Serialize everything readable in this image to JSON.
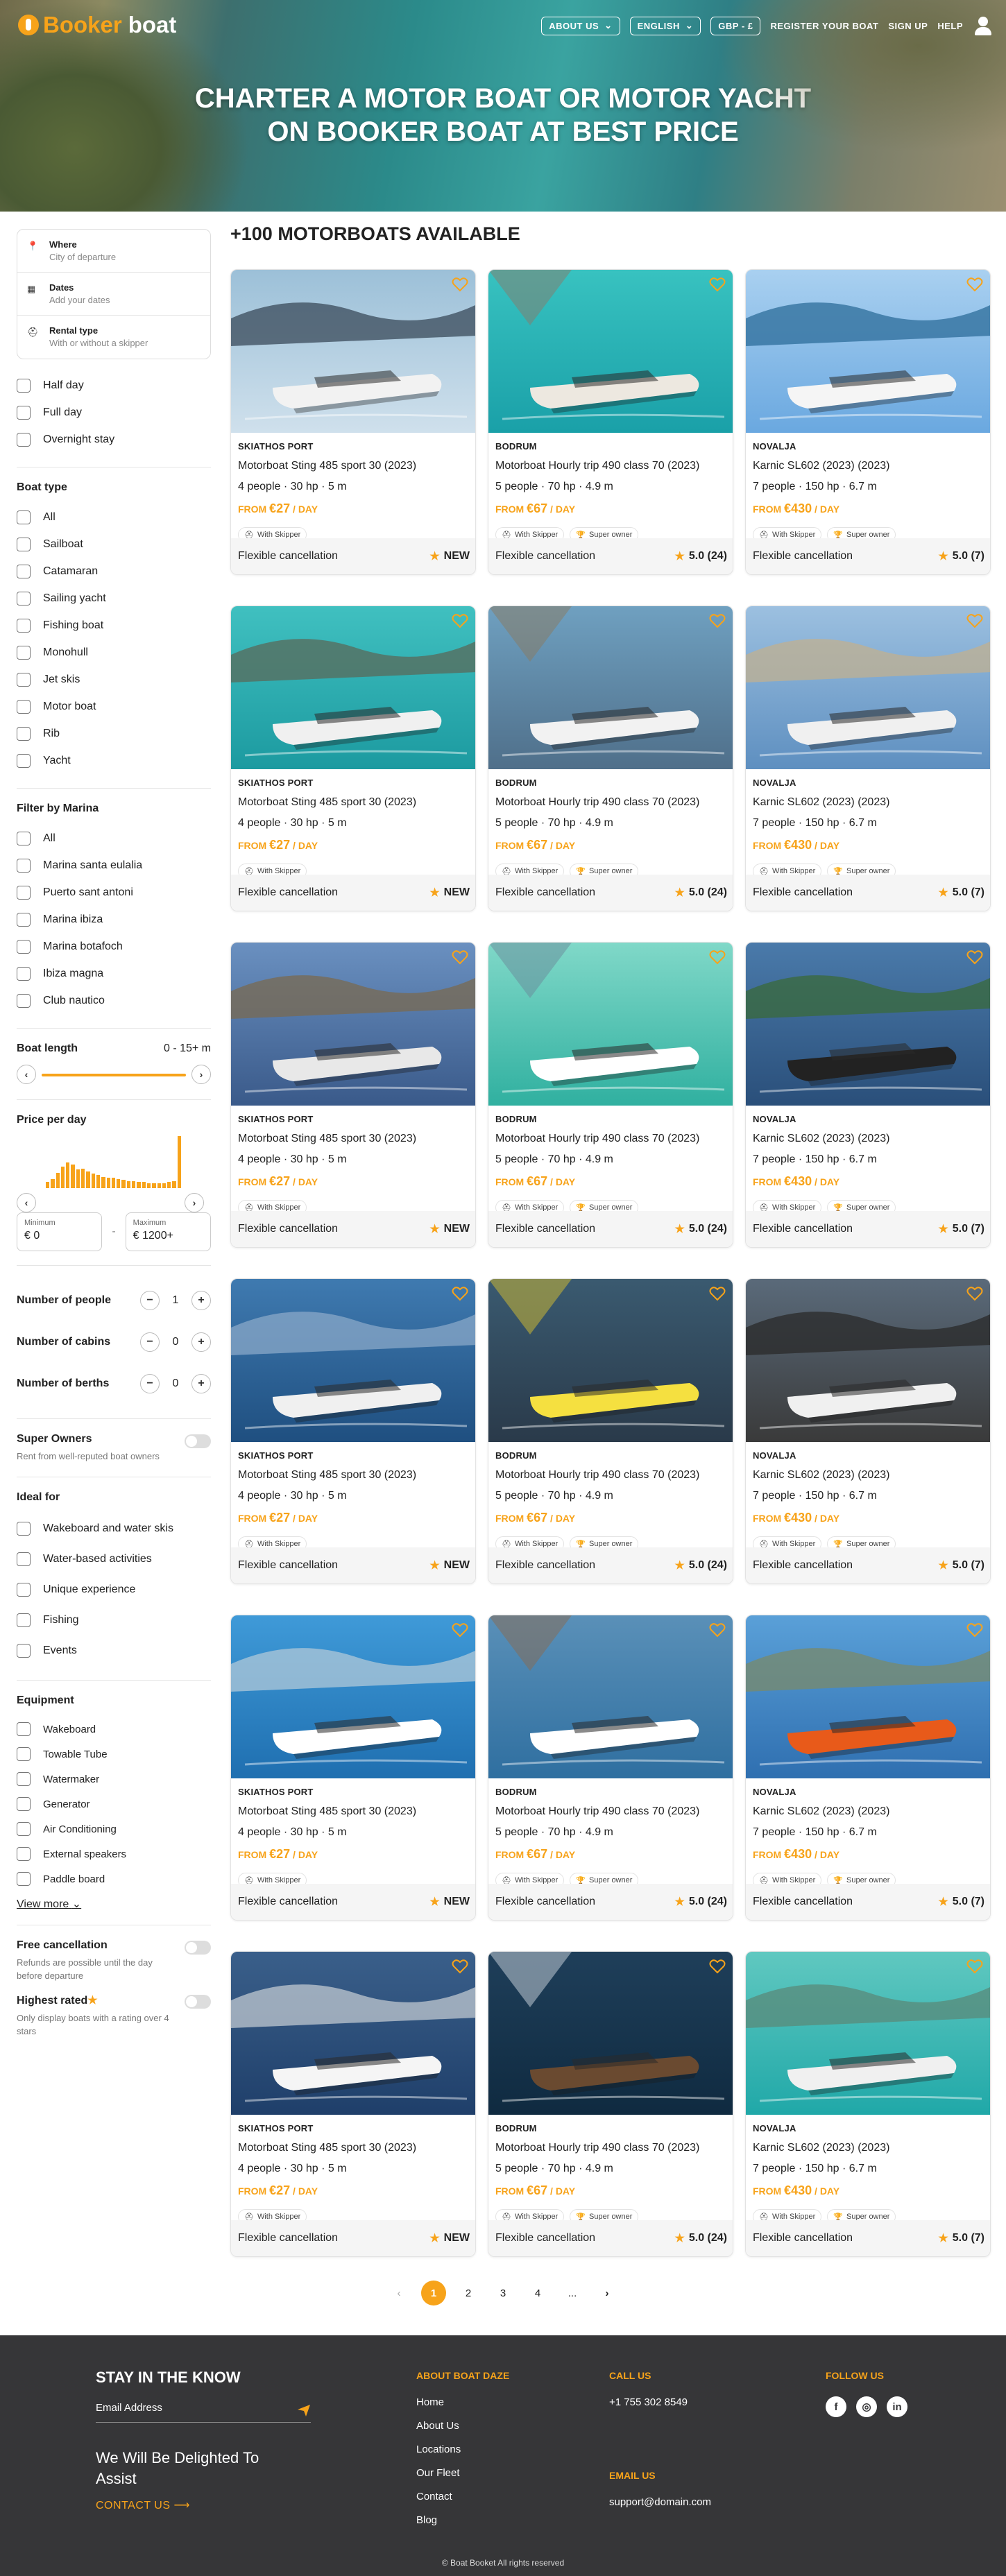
{
  "header": {
    "logo_a": "Booker",
    "logo_b": "boat",
    "about": "ABOUT US",
    "lang": "ENGLISH",
    "currency": "GBP - £",
    "register": "REGISTER YOUR BOAT",
    "signup": "SIGN UP",
    "help": "HELP"
  },
  "hero": {
    "title_line1": "CHARTER A MOTOR BOAT OR MOTOR YACHT",
    "title_line2": "ON BOOKER BOAT AT BEST PRICE"
  },
  "search": {
    "where_label": "Where",
    "where_ph": "City of departure",
    "dates_label": "Dates",
    "dates_ph": "Add your dates",
    "rental_label": "Rental type",
    "rental_ph": "With or without a skipper"
  },
  "durations": [
    "Half day",
    "Full day",
    "Overnight stay"
  ],
  "boat_type": {
    "title": "Boat type",
    "items": [
      "All",
      "Sailboat",
      "Catamaran",
      "Sailing yacht",
      "Fishing boat",
      "Monohull",
      "Jet skis",
      "Motor boat",
      "Rib",
      "Yacht"
    ]
  },
  "marina": {
    "title": "Filter by Marina",
    "items": [
      "All",
      "Marina santa eulalia",
      "Puerto sant antoni",
      "Marina ibiza",
      "Marina botafoch",
      "Ibiza magna",
      "Club nautico"
    ]
  },
  "boat_length": {
    "title": "Boat length",
    "range": "0 - 15+ m"
  },
  "price": {
    "title": "Price per day",
    "min_label": "Minimum",
    "min_value": "€  0",
    "max_label": "Maximum",
    "max_value": "€  1200+",
    "histogram": [
      0.12,
      0.18,
      0.3,
      0.42,
      0.5,
      0.46,
      0.36,
      0.38,
      0.32,
      0.28,
      0.26,
      0.22,
      0.2,
      0.2,
      0.18,
      0.16,
      0.14,
      0.13,
      0.12,
      0.12,
      0.1,
      0.1,
      0.1,
      0.1,
      0.12,
      0.14,
      1.0
    ]
  },
  "steppers": [
    {
      "label": "Number of people",
      "value": "1"
    },
    {
      "label": "Number of cabins",
      "value": "0"
    },
    {
      "label": "Number of berths",
      "value": "0"
    }
  ],
  "super_owners": {
    "title": "Super Owners",
    "sub": "Rent from well-reputed boat owners"
  },
  "ideal_for": {
    "title": "Ideal for",
    "items": [
      "Wakeboard and water skis",
      "Water-based activities",
      "Unique experience",
      "Fishing",
      "Events"
    ]
  },
  "equipment": {
    "title": "Equipment",
    "items": [
      "Wakeboard",
      "Towable Tube",
      "Watermaker",
      "Generator",
      "Air Conditioning",
      "External speakers",
      "Paddle board"
    ],
    "view_more": "View more"
  },
  "free_cancel": {
    "title": "Free cancellation",
    "sub": "Refunds are possible until the day before departure"
  },
  "highest_rated": {
    "title": "Highest rated",
    "sub": "Only display boats with a rating over 4 stars"
  },
  "main": {
    "title": "+100 MOTORBOATS AVAILABLE"
  },
  "card_templates": [
    {
      "loc": "SKIATHOS PORT",
      "name": "Motorboat Sting 485 sport 30 (2023)",
      "specs": "4 people · 30 hp · 5 m",
      "price": "€27",
      "tags": [
        "With Skipper"
      ],
      "foot": "Flexible cancellation",
      "rating": "NEW"
    },
    {
      "loc": "BODRUM",
      "name": "Motorboat Hourly trip 490 class 70 (2023)",
      "specs": "5 people · 70 hp · 4.9 m",
      "price": "€67",
      "tags": [
        "With Skipper",
        "Super owner"
      ],
      "foot": "Flexible cancellation",
      "rating": "5.0 (24)"
    },
    {
      "loc": "NOVALJA",
      "name": "Karnic SL602 (2023) (2023)",
      "specs": "7 people · 150 hp · 6.7 m",
      "price": "€430",
      "tags": [
        "With Skipper",
        "Super owner"
      ],
      "foot": "Flexible cancellation",
      "rating": "5.0 (7)"
    }
  ],
  "card_labels": {
    "from": "FROM",
    "per": "/ DAY"
  },
  "image_palettes": [
    [
      "#cfe0ec",
      "#9cc0d8",
      "#3a4a5a",
      "#f2f2f2"
    ],
    [
      "#1aa0a8",
      "#38c2c0",
      "#8a7a6a",
      "#ede8e0"
    ],
    [
      "#6aa8e0",
      "#a9d0f0",
      "#2c6c9a",
      "#f5f5f5"
    ],
    [
      "#1c9aa0",
      "#40c0c0",
      "#5a6a5a",
      "#f0f0f0"
    ],
    [
      "#4f6f8a",
      "#6fa0c0",
      "#8a7a60",
      "#f2f2f2"
    ],
    [
      "#5e8fc0",
      "#9cc0e0",
      "#c0b090",
      "#f0f0f0"
    ],
    [
      "#3a5a8a",
      "#6a90c0",
      "#7a6a50",
      "#e8e8e8"
    ],
    [
      "#30b0a0",
      "#80d8c8",
      "#6a8a9a",
      "#ffffff"
    ],
    [
      "#2a4f7a",
      "#4a7aaa",
      "#3a6a3a",
      "#222222"
    ],
    [
      "#1f4f80",
      "#3f7ab0",
      "#8aa8c8",
      "#f0f0f0"
    ],
    [
      "#2a3a4a",
      "#3a5a70",
      "#d8c030",
      "#f5e040"
    ],
    [
      "#3a3a3a",
      "#5a6a7a",
      "#2a2a2a",
      "#f0f0f0"
    ],
    [
      "#1f6fb0",
      "#3f9ad8",
      "#b0c8d8",
      "#ffffff"
    ],
    [
      "#2f6fa0",
      "#5a90b8",
      "#8a6a50",
      "#ffffff"
    ],
    [
      "#2f6fb0",
      "#5aa0d8",
      "#7a8a6a",
      "#e85a1a"
    ],
    [
      "#1f3f6a",
      "#3a5f8a",
      "#c0c8d0",
      "#f5f5f5"
    ],
    [
      "#0f2a40",
      "#1f3f5a",
      "#d0d8e0",
      "#6a4a30"
    ],
    [
      "#20a8a8",
      "#60c8c0",
      "#5a8a7a",
      "#f0f0f0"
    ]
  ],
  "pagination": {
    "prev": "‹",
    "pages": [
      "1",
      "2",
      "3",
      "4",
      "..."
    ],
    "next": "›"
  },
  "footer": {
    "stay": "STAY IN THE KNOW",
    "email_ph": "Email Address",
    "delight": "We Will Be Delighted To Assist",
    "contact": "CONTACT US",
    "about_h": "ABOUT BOAT DAZE",
    "about_links": [
      "Home",
      "About Us",
      "Locations",
      "Our Fleet",
      "Contact",
      "Blog"
    ],
    "call_h": "CALL US",
    "phone": "+1 755 302 8549",
    "email_h": "EMAIL US",
    "email": "support@domain.com",
    "follow_h": "FOLLOW US",
    "copyright": "© Boat Booket All rights reserved"
  },
  "colors": {
    "accent": "#f7a31a",
    "footer_bg": "#363638"
  }
}
